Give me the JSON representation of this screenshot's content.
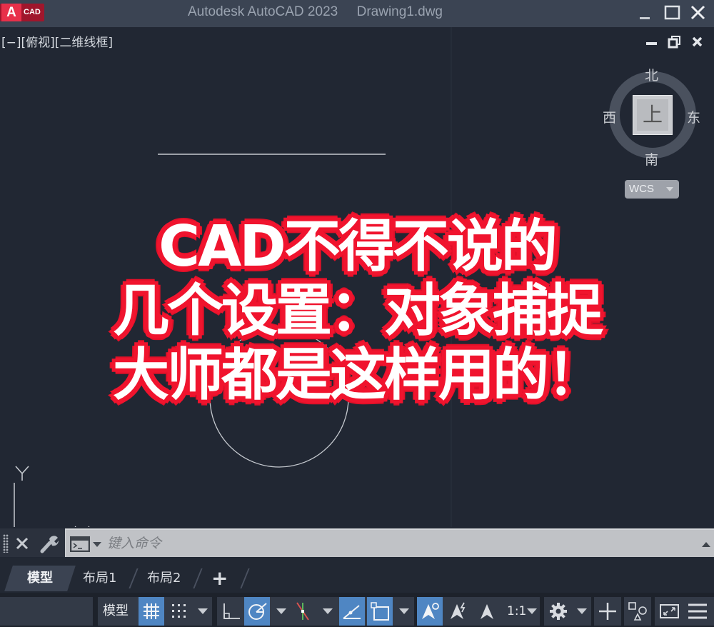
{
  "titlebar": {
    "logo_letter": "A",
    "logo_text": "CAD",
    "app_title": "Autodesk AutoCAD 2023",
    "document": "Drawing1.dwg",
    "minimize_icon": "minimize-icon",
    "maximize_icon": "maximize-icon",
    "close_icon": "close-icon"
  },
  "viewport": {
    "label": "[−][俯视][二维线框]",
    "controls": [
      "minimize-viewport-icon",
      "restore-viewport-icon",
      "close-viewport-icon"
    ]
  },
  "viewcube": {
    "north": "北",
    "south": "南",
    "east": "东",
    "west": "西",
    "face": "上",
    "ucs_menu": "WCS"
  },
  "ucs_icon": {
    "y_label": "Y"
  },
  "overlay_caption": {
    "lines": [
      "CAD不得不说的",
      "几个设置：对象捕捉",
      "大师都是这样用的！"
    ],
    "text_color": "#ffffff",
    "outline_color": "#f0142e"
  },
  "command_line": {
    "placeholder": "键入命令",
    "value": ""
  },
  "layout_tabs": {
    "tabs": [
      {
        "label": "模型",
        "active": true
      },
      {
        "label": "布局1",
        "active": false
      },
      {
        "label": "布局2",
        "active": false
      }
    ],
    "add_label": "+"
  },
  "statusbar": {
    "model_label": "模型",
    "scale_label": "1:1",
    "buttons": [
      {
        "name": "grid",
        "on": true
      },
      {
        "name": "snap",
        "on": false
      },
      {
        "name": "ortho",
        "on": false
      },
      {
        "name": "polar",
        "on": true
      },
      {
        "name": "isodraft",
        "on": false
      },
      {
        "name": "object-snap-tracking",
        "on": true
      },
      {
        "name": "object-snap",
        "on": true
      },
      {
        "name": "annotation-visibility",
        "on": true
      },
      {
        "name": "auto-scale",
        "on": false
      },
      {
        "name": "annotation-scale",
        "on": false
      },
      {
        "name": "workspace",
        "on": false
      },
      {
        "name": "annotation-monitor",
        "on": false
      },
      {
        "name": "isolate-objects",
        "on": false
      },
      {
        "name": "fullscreen",
        "on": false
      },
      {
        "name": "customization",
        "on": false
      }
    ]
  },
  "colors": {
    "canvas": "#212733",
    "titlebar": "#3b4453",
    "accent_on": "#4f86c3",
    "logo_red": "#e8304a"
  }
}
